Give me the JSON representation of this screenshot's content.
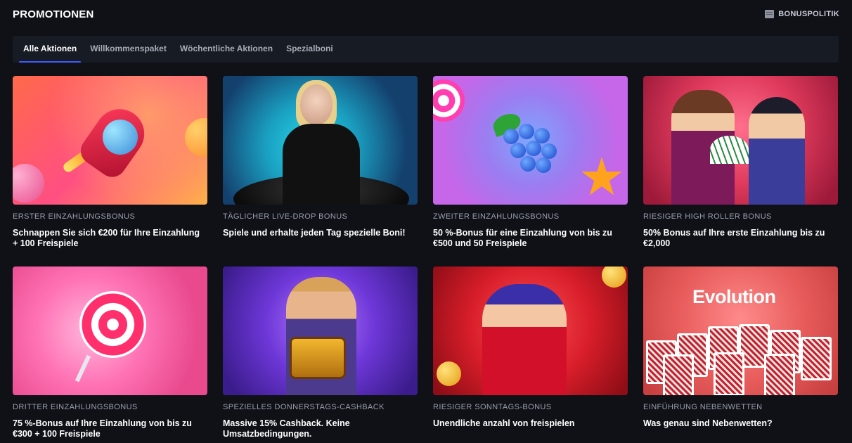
{
  "header": {
    "title": "PROMOTIONEN",
    "policy_label": "BONUSPOLITIK"
  },
  "tabs": [
    {
      "label": "Alle Aktionen",
      "active": true
    },
    {
      "label": "Willkommenspaket",
      "active": false
    },
    {
      "label": "Wöchentliche Aktionen",
      "active": false
    },
    {
      "label": "Spezialboni",
      "active": false
    }
  ],
  "promotions": [
    {
      "category": "ERSTER EINZAHLUNGSBONUS",
      "description": "Schnappen Sie sich €200 für Ihre Einzahlung + 100 Freispiele"
    },
    {
      "category": "TÄGLICHER LIVE-DROP BONUS",
      "description": "Spiele und erhalte jeden Tag spezielle Boni!"
    },
    {
      "category": "ZWEITER EINZAHLUNGSBONUS",
      "description": "50 %-Bonus für eine Einzahlung von bis zu €500 und 50 Freispiele"
    },
    {
      "category": "RIESIGER HIGH ROLLER BONUS",
      "description": "50% Bonus auf Ihre erste Einzahlung bis zu €2,000"
    },
    {
      "category": "DRITTER EINZAHLUNGSBONUS",
      "description": "75 %-Bonus auf Ihre Einzahlung von bis zu €300 + 100 Freispiele"
    },
    {
      "category": "SPEZIELLES DONNERSTAGS-CASHBACK",
      "description": "Massive 15% Cashback. Keine Umsatzbedingungen."
    },
    {
      "category": "RIESIGER SONNTAGS-BONUS",
      "description": "Unendliche anzahl von freispielen"
    },
    {
      "category": "EINFÜHRUNG NEBENWETTEN",
      "description": "Was genau sind Nebenwetten?"
    }
  ],
  "art": {
    "evolution_logo": "Evolution"
  },
  "icons": {
    "policy": "document-icon"
  },
  "colors": {
    "background": "#0f1117",
    "tab_bar": "#171b24",
    "active_tab_underline": "#3e5cff",
    "category_text": "#9a9fab"
  }
}
